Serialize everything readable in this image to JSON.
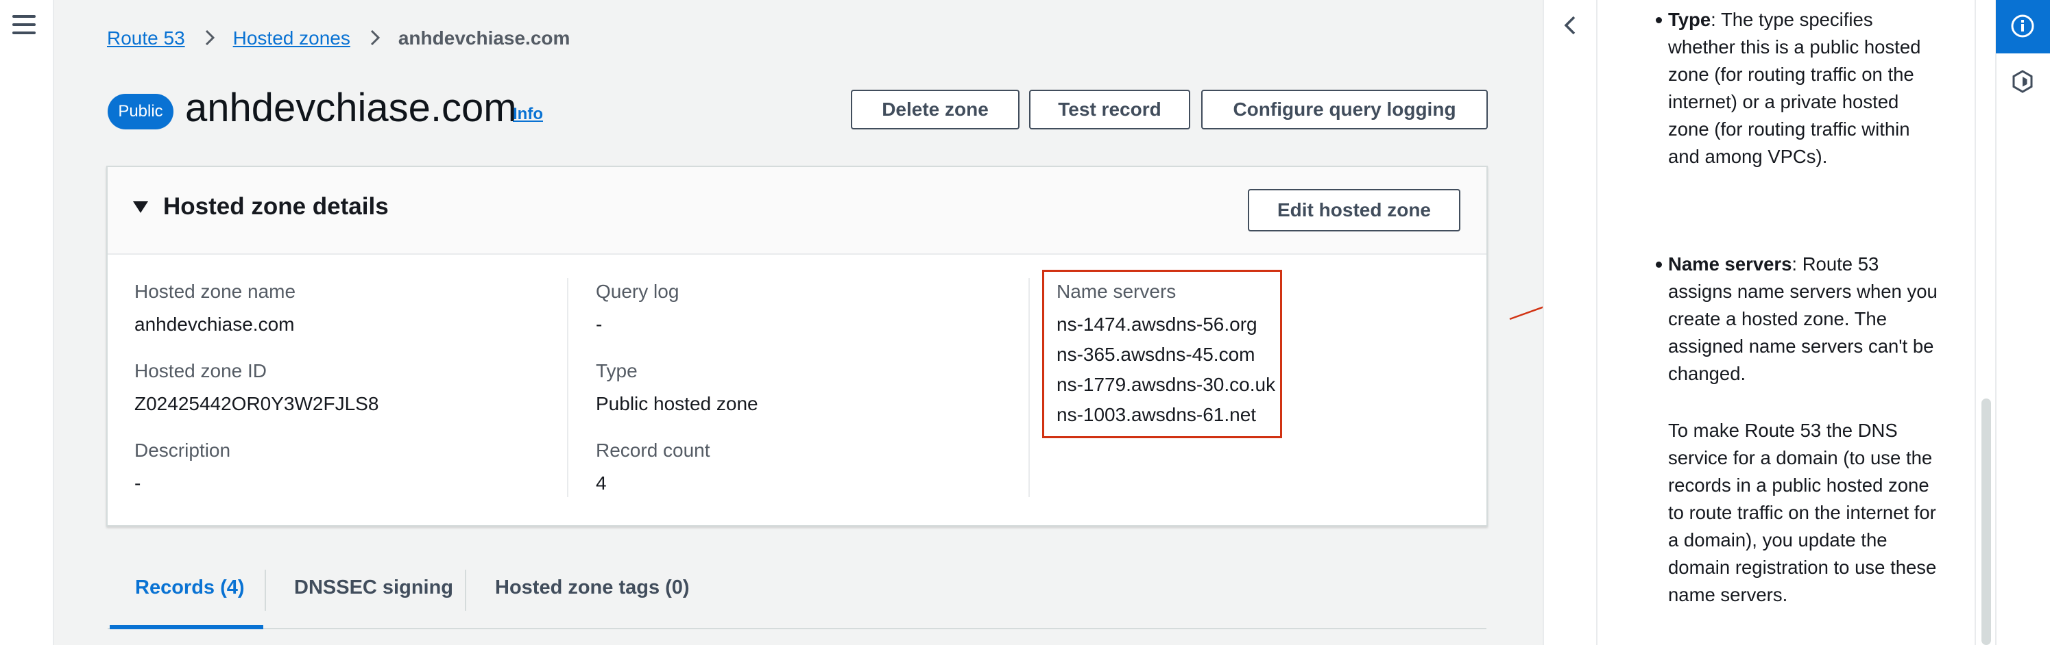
{
  "breadcrumbs": {
    "items": [
      "Route 53",
      "Hosted zones"
    ],
    "current": "anhdevchiase.com"
  },
  "header": {
    "badge": "Public",
    "title": "anhdevchiase.com",
    "info_link": "Info",
    "buttons": {
      "delete": "Delete zone",
      "test": "Test record",
      "logging": "Configure query logging"
    }
  },
  "details": {
    "title": "Hosted zone details",
    "edit_button": "Edit hosted zone",
    "hosted_zone_name": {
      "label": "Hosted zone name",
      "value": "anhdevchiase.com"
    },
    "hosted_zone_id": {
      "label": "Hosted zone ID",
      "value": "Z02425442OR0Y3W2FJLS8"
    },
    "description": {
      "label": "Description",
      "value": "-"
    },
    "query_log": {
      "label": "Query log",
      "value": "-"
    },
    "type": {
      "label": "Type",
      "value": "Public hosted zone"
    },
    "record_count": {
      "label": "Record count",
      "value": "4"
    },
    "name_servers": {
      "label": "Name servers",
      "values": [
        "ns-1474.awsdns-56.org",
        "ns-365.awsdns-45.com",
        "ns-1779.awsdns-30.co.uk",
        "ns-1003.awsdns-61.net"
      ]
    }
  },
  "tabs": [
    {
      "label": "Records (4)",
      "active": true
    },
    {
      "label": "DNSSEC signing",
      "active": false
    },
    {
      "label": "Hosted zone tags (0)",
      "active": false
    }
  ],
  "help": {
    "type_term": "Type",
    "type_text": ": The type specifies whether this is a public hosted zone (for routing traffic on the internet) or a private hosted zone (for routing traffic within and among VPCs).",
    "ns_term": "Name servers",
    "ns_text": ": Route 53 assigns name servers when you create a hosted zone. The assigned name servers can't be changed.",
    "paragraph": "To make Route 53 the DNS service for a domain (to use the records in a public hosted zone to route traffic on the internet for a domain), you update the domain registration to use these name servers."
  },
  "icons": {
    "menu": "hamburger-menu-icon",
    "collapse": "chevron-left-icon",
    "info": "info-circle-icon",
    "tool": "hexagon-tool-icon"
  },
  "colors": {
    "accent": "#0972d3",
    "highlight": "#d13212",
    "background": "#f2f3f3"
  }
}
